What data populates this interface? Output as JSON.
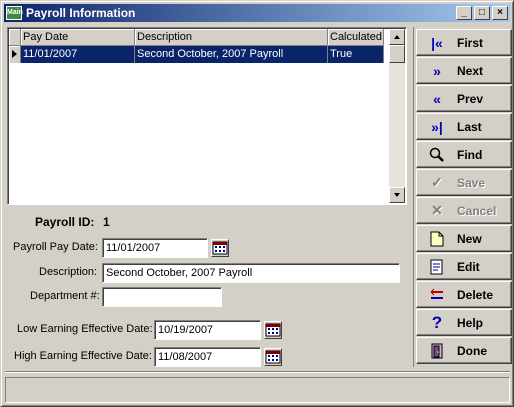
{
  "window": {
    "title": "Payroll Information",
    "icon_label": "Main"
  },
  "grid": {
    "columns": [
      "Pay Date",
      "Description",
      "Calculated"
    ],
    "rows": [
      {
        "pay_date": "11/01/2007",
        "description": "Second October, 2007 Payroll",
        "calculated": "True"
      }
    ]
  },
  "form": {
    "payroll_id_label": "Payroll ID:",
    "payroll_id": "1",
    "pay_date_label": "Payroll Pay Date:",
    "pay_date": "11/01/2007",
    "description_label": "Description:",
    "description": "Second October, 2007 Payroll",
    "department_label": "Department #:",
    "department": "",
    "low_date_label": "Low Earning Effective Date:",
    "low_date": "10/19/2007",
    "high_date_label": "High Earning Effective Date:",
    "high_date": "11/08/2007"
  },
  "buttons": {
    "first": "First",
    "next": "Next",
    "prev": "Prev",
    "last": "Last",
    "find": "Find",
    "save": "Save",
    "cancel": "Cancel",
    "new": "New",
    "edit": "Edit",
    "delete": "Delete",
    "help": "Help",
    "done": "Done"
  },
  "colors": {
    "title_start": "#0a246a",
    "title_end": "#a6caf0",
    "selection": "#0a246a",
    "face": "#d4d0c8"
  }
}
